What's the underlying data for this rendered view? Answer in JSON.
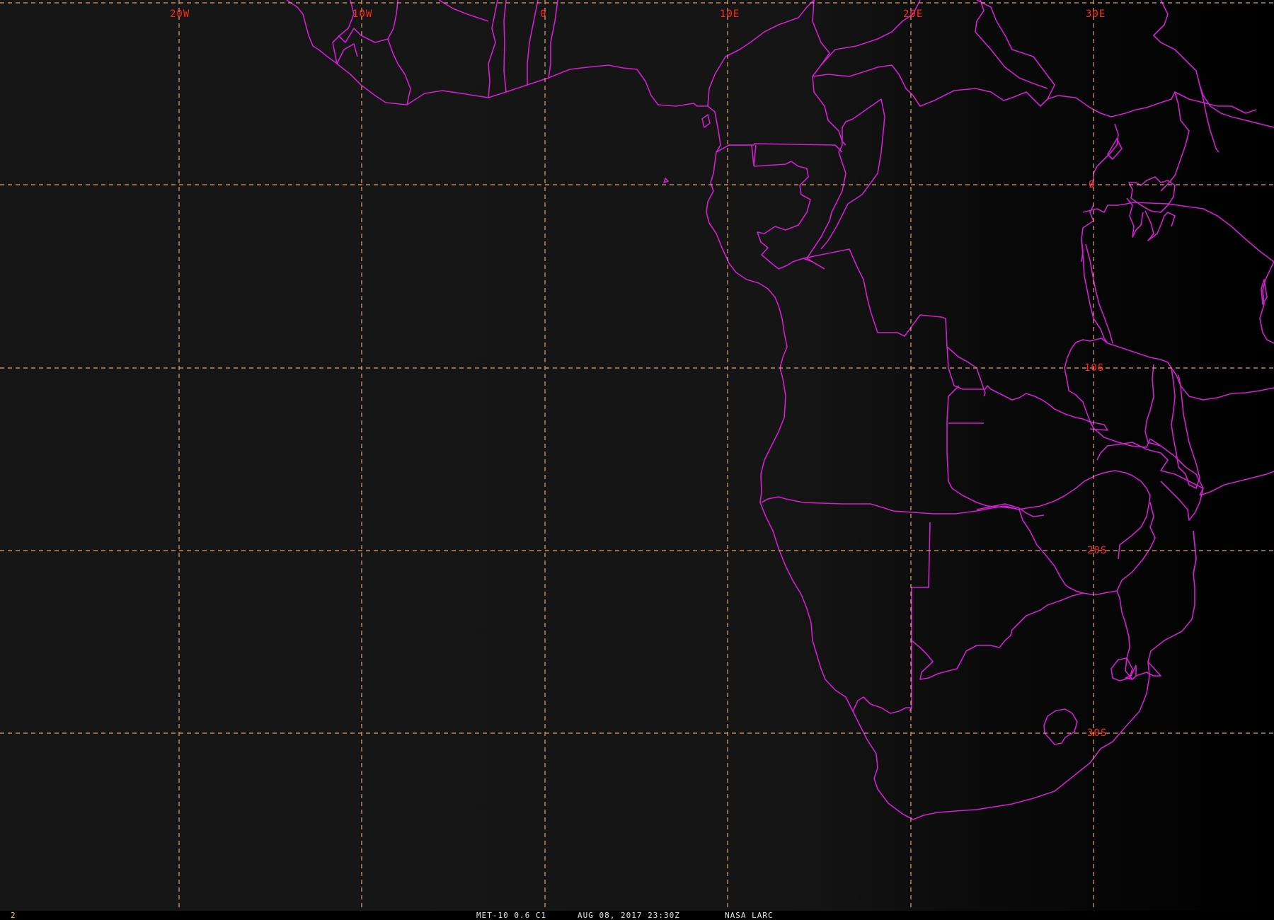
{
  "map": {
    "background_color": "#161616",
    "grid_color": "#e0a070",
    "border_color": "#d020d0",
    "label_color": "#ff2a1a",
    "longitude_labels": [
      "20W",
      "10W",
      "0",
      "10E",
      "20E",
      "30E"
    ],
    "latitude_labels": [
      "0",
      "10S",
      "20S",
      "30S"
    ]
  },
  "status_bar": {
    "frame_number": "2",
    "product": "MET-10 0.6 C1",
    "datetime": "AUG 08, 2017 23:30Z",
    "source": "NASA LARC"
  }
}
